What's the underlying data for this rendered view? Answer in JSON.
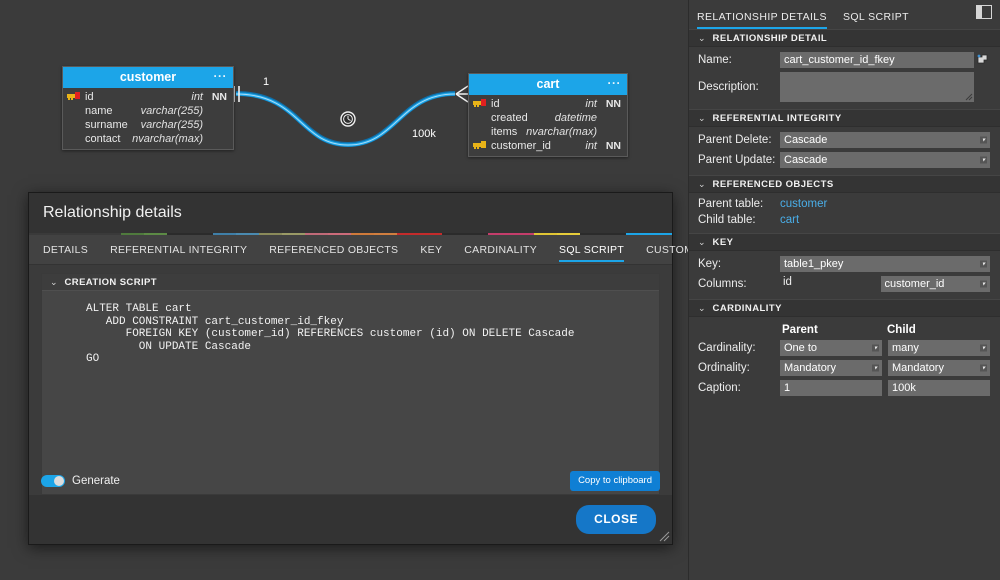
{
  "canvas": {
    "tables": [
      {
        "name": "customer",
        "menu_icon": "···",
        "columns": [
          {
            "key": "pk",
            "name": "id",
            "type": "int",
            "nn": "NN"
          },
          {
            "key": "",
            "name": "name",
            "type": "varchar(255)",
            "nn": ""
          },
          {
            "key": "",
            "name": "surname",
            "type": "varchar(255)",
            "nn": ""
          },
          {
            "key": "",
            "name": "contact",
            "type": "nvarchar(max)",
            "nn": ""
          }
        ]
      },
      {
        "name": "cart",
        "menu_icon": "···",
        "columns": [
          {
            "key": "pk",
            "name": "id",
            "type": "int",
            "nn": "NN"
          },
          {
            "key": "",
            "name": "created",
            "type": "datetime",
            "nn": ""
          },
          {
            "key": "",
            "name": "items",
            "type": "nvarchar(max)",
            "nn": ""
          },
          {
            "key": "fk",
            "name": "customer_id",
            "type": "int",
            "nn": "NN"
          }
        ]
      }
    ],
    "connector": {
      "parent_caption": "1",
      "child_caption": "100k",
      "midpoint_icon": "clock-icon",
      "line_color": "#1ca5e8"
    }
  },
  "dialog": {
    "title": "Relationship details",
    "tabs": [
      {
        "label": "DETAILS",
        "active": false
      },
      {
        "label": "REFERENTIAL INTEGRITY",
        "active": false
      },
      {
        "label": "REFERENCED OBJECTS",
        "active": false
      },
      {
        "label": "KEY",
        "active": false
      },
      {
        "label": "CARDINALITY",
        "active": false
      },
      {
        "label": "SQL SCRIPT",
        "active": true
      },
      {
        "label": "CUSTOM CODE",
        "active": false
      }
    ],
    "section": {
      "caret": "⌄",
      "label": "CREATION SCRIPT"
    },
    "sql": "ALTER TABLE cart\n   ADD CONSTRAINT cart_customer_id_fkey\n      FOREIGN KEY (customer_id) REFERENCES customer (id) ON DELETE Cascade\n        ON UPDATE Cascade\nGO",
    "generate_label": "Generate",
    "generate_on": true,
    "copy_label": "Copy to clipboard",
    "close_label": "CLOSE",
    "rainbow_colors": [
      "#3a3a3a",
      "#3a3a3a",
      "#3a3a3a",
      "#3a3a3a",
      "#4f7a3d",
      "#5c8a45",
      "#2b2b2b",
      "#2b2b2b",
      "#3f7fa8",
      "#4a8ab0",
      "#8a8a5a",
      "#9a9a66",
      "#c06a78",
      "#cc6b7a",
      "#cf7a3a",
      "#d07e3f",
      "#c42b2b",
      "#c42b2b",
      "#2b2b2b",
      "#2b2b2b",
      "#c43d6b",
      "#c43d6b",
      "#e0c534",
      "#e6cc3a",
      "#2b2b2b",
      "#2b2b2b",
      "#1ca5e8",
      "#1ca5e8"
    ]
  },
  "inspector": {
    "tabs": [
      {
        "label": "RELATIONSHIP DETAILS",
        "active": true
      },
      {
        "label": "SQL SCRIPT",
        "active": false
      }
    ],
    "layout_icon": "panel-layout-icon",
    "sections": {
      "relationship_detail": {
        "caret": "⌄",
        "label": "RELATIONSHIP DETAIL",
        "name_label": "Name:",
        "name_value": "cart_customer_id_fkey",
        "name_icon": "pick-name-icon",
        "description_label": "Description:",
        "description_value": ""
      },
      "referential_integrity": {
        "caret": "⌄",
        "label": "REFERENTIAL INTEGRITY",
        "parent_delete_label": "Parent Delete:",
        "parent_delete_value": "Cascade",
        "parent_update_label": "Parent Update:",
        "parent_update_value": "Cascade"
      },
      "referenced_objects": {
        "caret": "⌄",
        "label": "REFERENCED OBJECTS",
        "parent_table_label": "Parent table:",
        "parent_table_value": "customer",
        "child_table_label": "Child table:",
        "child_table_value": "cart"
      },
      "key": {
        "caret": "⌄",
        "label": "KEY",
        "key_label": "Key:",
        "key_value": "table1_pkey",
        "columns_label": "Columns:",
        "columns_parent_value": "id",
        "columns_child_value": "customer_id"
      },
      "cardinality": {
        "caret": "⌄",
        "label": "CARDINALITY",
        "col_parent": "Parent",
        "col_child": "Child",
        "cardinality_label": "Cardinality:",
        "cardinality_parent": "One to",
        "cardinality_child": "many",
        "ordinality_label": "Ordinality:",
        "ordinality_parent": "Mandatory",
        "ordinality_child": "Mandatory",
        "caption_label": "Caption:",
        "caption_parent": "1",
        "caption_child": "100k"
      }
    }
  },
  "colors": {
    "accent": "#1ca5e8",
    "table_header": "#1ca5e8",
    "button_primary": "#1577c8",
    "link": "#4aaee8",
    "panel_bg": "#3b3b3b"
  }
}
